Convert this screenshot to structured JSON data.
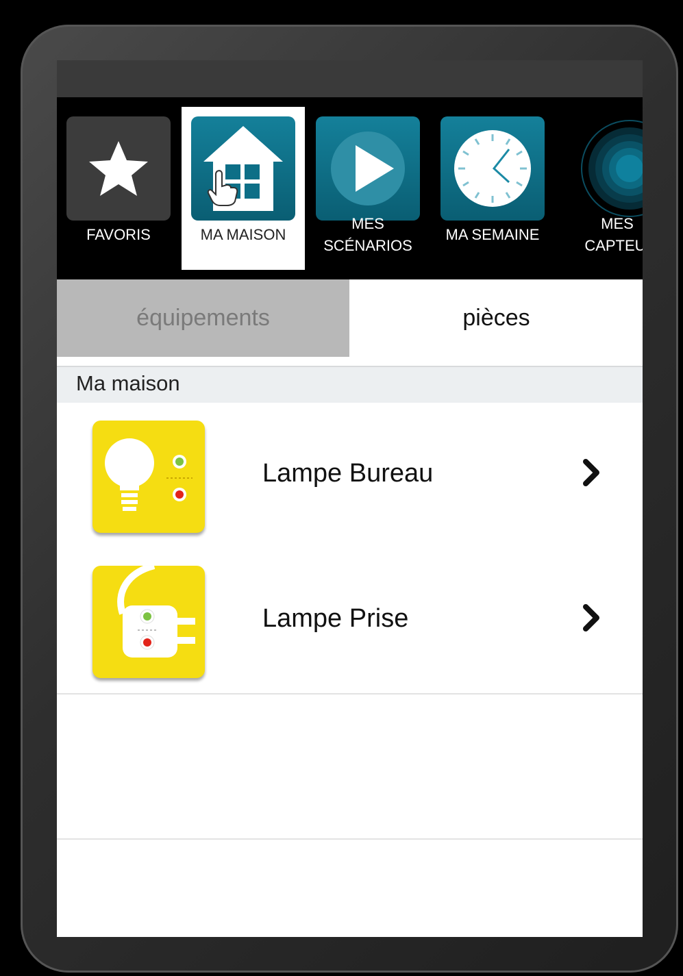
{
  "nav": {
    "items": [
      {
        "label_line1": "",
        "label_line2": "FAVORIS",
        "icon": "star-icon"
      },
      {
        "label_line1": "",
        "label_line2": "MA MAISON",
        "icon": "house-icon"
      },
      {
        "label_line1": "MES",
        "label_line2": "SCÉNARIOS",
        "icon": "play-icon"
      },
      {
        "label_line1": "",
        "label_line2": "MA SEMAINE",
        "icon": "clock-icon"
      },
      {
        "label_line1": "MES",
        "label_line2": "CAPTEUI",
        "icon": "sensor-icon"
      }
    ],
    "active_index": 1
  },
  "segments": {
    "left": "équipements",
    "right": "pièces",
    "active": "right"
  },
  "section": {
    "title": "Ma maison"
  },
  "devices": [
    {
      "name": "Lampe Bureau",
      "icon": "lightbulb-icon"
    },
    {
      "name": "Lampe Prise",
      "icon": "plug-icon"
    }
  ],
  "colors": {
    "tile_teal": "#0d6f87",
    "tile_dark": "#3c3c3c",
    "device_yellow": "#f5dd12",
    "segment_inactive": "#b8b8b8"
  }
}
